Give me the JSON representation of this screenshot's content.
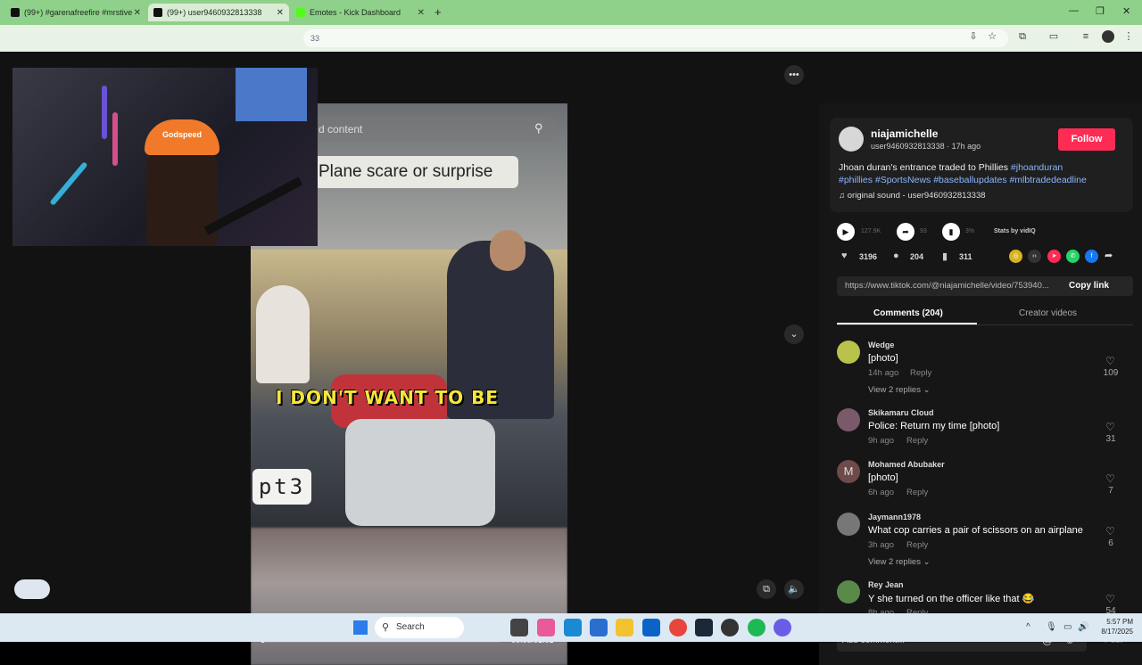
{
  "browser": {
    "tabs": [
      {
        "label": "(99+) #garenafreefire #mrstive",
        "active": false
      },
      {
        "label": "(99+) user9460932813338",
        "active": true
      },
      {
        "label": "Emotes - Kick Dashboard",
        "active": false
      }
    ],
    "new_tab": "+",
    "address_fragment": "33",
    "window_controls": [
      "—",
      "❐",
      "✕"
    ]
  },
  "webcam": {
    "cap_text": "Godspeed"
  },
  "video": {
    "search_text": "d content",
    "title_overlay": "Plane scare or surprise",
    "caption": "I DON'T WANT TO BE",
    "part_badge": "pt3",
    "time": "00:00/01:01",
    "progress_fraction": 0.0
  },
  "post": {
    "username": "niajamichelle",
    "user_handle_time": "user9460932813338 · 17h ago",
    "follow_label": "Follow",
    "description_plain": "Jhoan duran's entrance traded to Phillies ",
    "hashtags_line1": "#jhoanduran",
    "hashtags_line2": "#phillies #SportsNews #baseballupdates #mlbtradedeadline",
    "sound": "original sound - user9460932813338",
    "stats": {
      "plays": "127.9K",
      "shares": "93",
      "percent": "3%",
      "stats_by": "Stats by vidIQ"
    },
    "likes": "3196",
    "comments": "204",
    "saves": "311",
    "link": "https://www.tiktok.com/@niajamichelle/video/753940...",
    "copy_link_label": "Copy link"
  },
  "tabs": {
    "comments_label": "Comments (204)",
    "creator_label": "Creator videos"
  },
  "comments": [
    {
      "name": "Wedge",
      "text": "[photo]",
      "time": "14h ago",
      "reply": "Reply",
      "replies": "View 2 replies",
      "likes": "109",
      "color": "#b8c24a"
    },
    {
      "name": "Skikamaru Cloud",
      "text": "Police: Return my time [photo]",
      "time": "9h ago",
      "reply": "Reply",
      "replies": "",
      "likes": "31",
      "color": "#7a5a6a"
    },
    {
      "name": "Mohamed Abubaker",
      "text": "[photo]",
      "time": "6h ago",
      "reply": "Reply",
      "replies": "",
      "likes": "7",
      "color": "#6e4a4a",
      "initial": "M"
    },
    {
      "name": "Jaymann1978",
      "text": "What cop carries a pair of scissors on an airplane",
      "time": "3h ago",
      "reply": "Reply",
      "replies": "View 2 replies",
      "likes": "6",
      "color": "#777777"
    },
    {
      "name": "Rey Jean",
      "text": "Y she turned on the officer like that 😂",
      "time": "8h ago",
      "reply": "Reply",
      "replies": "",
      "likes": "54",
      "color": "#5a8a4a"
    }
  ],
  "comment_input": {
    "placeholder": "Add comment...",
    "post_label": "Post"
  },
  "taskbar": {
    "search_label": "Search",
    "time": "5:57 PM",
    "date": "8/17/2025"
  },
  "colors": {
    "follow": "#fe2c55",
    "hashtag": "#8bb6ff",
    "tabbar": "#8fd18a"
  }
}
